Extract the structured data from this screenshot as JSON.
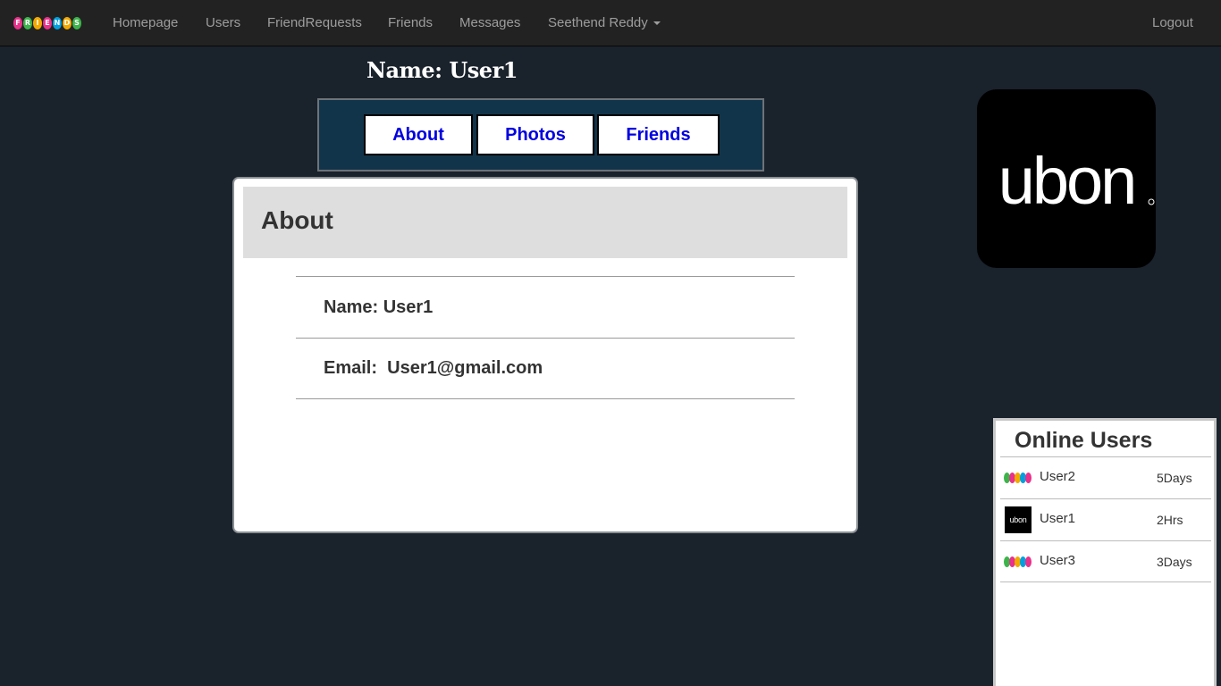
{
  "navbar": {
    "brand_letters": [
      "F",
      "R",
      "I",
      "E",
      "N",
      "D",
      "S"
    ],
    "brand_colors": [
      "#e8318a",
      "#3cb44b",
      "#f2a900",
      "#e8318a",
      "#00a0e0",
      "#f2a900",
      "#3cb44b"
    ],
    "items": [
      "Homepage",
      "Users",
      "FriendRequests",
      "Friends",
      "Messages"
    ],
    "account_label": "Seethend Reddy",
    "logout_label": "Logout"
  },
  "profile": {
    "heading": "Name: User1",
    "tabs": [
      "About",
      "Photos",
      "Friends"
    ],
    "logo_text": "ubon"
  },
  "about": {
    "title": "About",
    "name_label": "Name: ",
    "name_value": "User1",
    "email_label": "Email:  ",
    "email_value": "User1@gmail.com"
  },
  "online": {
    "title": "Online Users",
    "users": [
      {
        "name": "User2",
        "time": "5Days",
        "avatar": "colorful-logo"
      },
      {
        "name": "User1",
        "time": "2Hrs",
        "avatar": "ubon-logo"
      },
      {
        "name": "User3",
        "time": "3Days",
        "avatar": "colorful-logo"
      }
    ]
  },
  "colors": {
    "background": "#1a222c",
    "navbar": "#222222",
    "tab_bar": "#12344a",
    "tab_text": "#0000e0"
  }
}
